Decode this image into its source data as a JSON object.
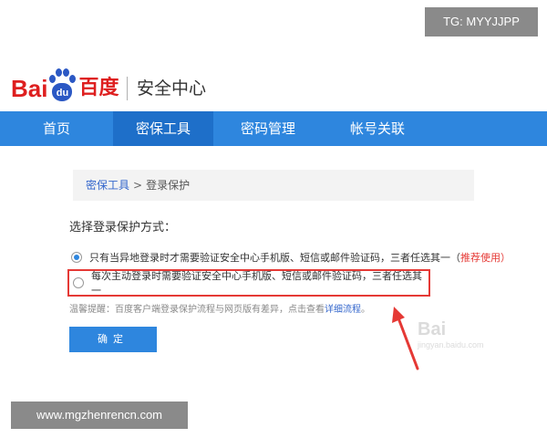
{
  "overlays": {
    "tg_label": "TG: MYYJJPP",
    "site_url": "www.mgzhenrencn.com"
  },
  "header": {
    "logo_bai": "Bai",
    "logo_du": "du",
    "logo_cn": "百度",
    "title": "安全中心"
  },
  "nav": {
    "items": [
      {
        "label": "首页"
      },
      {
        "label": "密保工具"
      },
      {
        "label": "密码管理"
      },
      {
        "label": "帐号关联"
      }
    ]
  },
  "breadcrumb": {
    "parent": "密保工具",
    "separator": ">",
    "current": "登录保护"
  },
  "form": {
    "section_label": "选择登录保护方式：",
    "option1_text": "只有当异地登录时才需要验证安全中心手机版、短信或邮件验证码，三者任选其一（",
    "option1_recommend": "推荐使用",
    "option1_close": "）",
    "option2_text": "每次主动登录时需要验证安全中心手机版、短信或邮件验证码，三者任选其一",
    "tip_text": "温馨提醒：百度客户端登录保护流程与网页版有差异，点击查看",
    "tip_link": "详细流程",
    "tip_end": "。",
    "confirm_label": "确定"
  },
  "watermark": {
    "logo": "Bai",
    "url": "jingyan.baidu.com"
  },
  "colors": {
    "nav_blue": "#2e86de",
    "nav_active": "#1e6fc9",
    "highlight_red": "#e53935",
    "baidu_red": "#de1f1f",
    "baidu_blue": "#2b58c4"
  }
}
